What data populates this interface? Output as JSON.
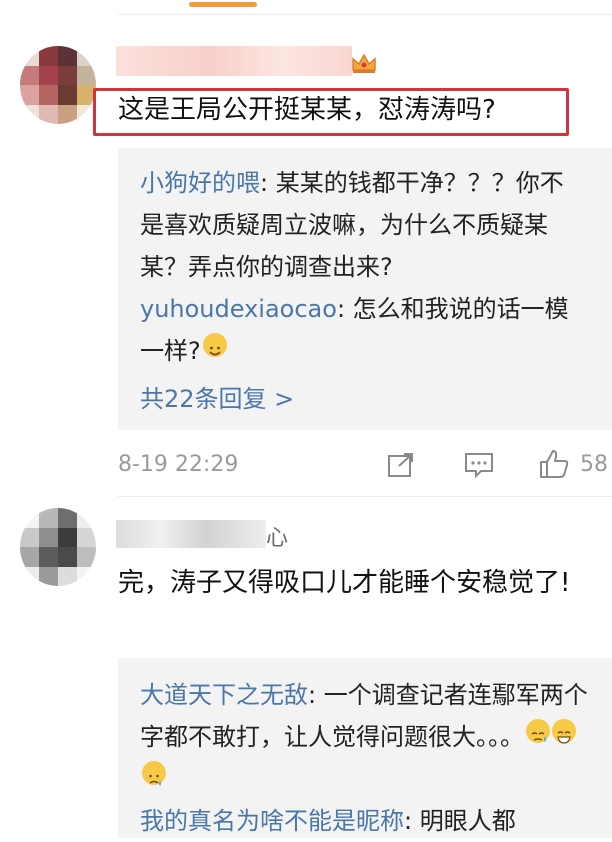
{
  "comment1": {
    "text": "这是王局公开挺某某，怼涛涛吗?",
    "replies": [
      {
        "user": "小狗好的喂",
        "sep": ": ",
        "text": "某某的钱都干净？？？你不是喜欢质疑周立波嘛，为什么不质疑某某？弄点你的调查出来?"
      },
      {
        "user": "yuhoudexiaocao",
        "sep": ": ",
        "text": "怎么和我说的话一模一样?"
      }
    ],
    "more_replies": "共22条回复 >",
    "time": "8-19 22:29",
    "likes": "58",
    "icons": [
      "share-icon",
      "comment-icon",
      "like-icon"
    ]
  },
  "comment2": {
    "name_visible": "心",
    "text": "完，涛子又得吸口儿才能睡个安稳觉了!",
    "replies": [
      {
        "user": "大道天下之无敌",
        "sep": ": ",
        "text": "一个调查记者连鄢军两个字都不敢打，让人觉得问题很大。。。"
      },
      {
        "user": "我的真名为啥不能是昵称",
        "sep": ": ",
        "text": "明眼人都"
      }
    ]
  },
  "colors": {
    "accent": "#f09a3a",
    "highlight_box": "#d0343c",
    "link": "#4a77a8",
    "reply_bg": "#f3f3f3",
    "meta": "#9a9a9a"
  }
}
